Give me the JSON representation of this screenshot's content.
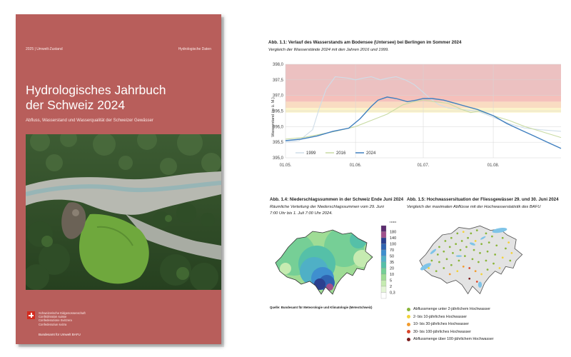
{
  "cover": {
    "top_left": "2025 | Umwelt-Zustand",
    "top_right": "Hydrologische Daten",
    "title_line1": "Hydrologisches Jahrbuch",
    "title_line2": "der Schweiz 2024",
    "subtitle": "Abfluss, Wasserstand und Wasserqualität der Schweizer Gewässer",
    "confederation": [
      "Schweizerische Eidgenossenschaft",
      "Confédération suisse",
      "Confederazione Svizzera",
      "Confederaziun svizra"
    ],
    "office": "Bundesamt für Umwelt BAFU",
    "colors": {
      "background": "#b85e5b"
    }
  },
  "fig11": {
    "title": "Abb. 1.1: Verlauf des Wasserstands am Bodensee (Untersee) bei Berlingen im Sommer 2024",
    "subtitle": "Vergleich der Wasserstände 2024 mit den Jahren 2016 und 1999.",
    "chart_data": {
      "type": "line",
      "ylabel": "Wasserstand (m ü. M.)",
      "ylim": [
        395.0,
        398.0
      ],
      "yticks": [
        "398,0",
        "397,5",
        "397,0",
        "396,5",
        "396,0",
        "395,5",
        "395,0"
      ],
      "x_axis": {
        "start": "2024-05-01",
        "end": "2024-08-31"
      },
      "xticks": [
        {
          "date": "2024-05-01",
          "label": "01.05."
        },
        {
          "date": "2024-06-01",
          "label": "01.06."
        },
        {
          "date": "2024-07-01",
          "label": "01.07."
        },
        {
          "date": "2024-08-01",
          "label": "01.08."
        }
      ],
      "bands": [
        {
          "from": 397.0,
          "to": 398.0,
          "color": "#ecc1c1"
        },
        {
          "from": 396.8,
          "to": 397.0,
          "color": "#f5c0bb"
        },
        {
          "from": 396.6,
          "to": 396.8,
          "color": "#f9dcc2"
        },
        {
          "from": 396.45,
          "to": 396.6,
          "color": "#fbf3c9"
        }
      ],
      "series": [
        {
          "name": "1999",
          "color": "#cfdde8",
          "points": [
            [
              "2024-05-01",
              395.5
            ],
            [
              "2024-05-07",
              395.55
            ],
            [
              "2024-05-13",
              395.9
            ],
            [
              "2024-05-16",
              396.6
            ],
            [
              "2024-05-19",
              397.2
            ],
            [
              "2024-05-23",
              397.6
            ],
            [
              "2024-05-29",
              397.55
            ],
            [
              "2024-06-01",
              397.5
            ],
            [
              "2024-06-04",
              397.55
            ],
            [
              "2024-06-08",
              397.6
            ],
            [
              "2024-06-12",
              397.5
            ],
            [
              "2024-06-15",
              397.55
            ],
            [
              "2024-06-19",
              397.6
            ],
            [
              "2024-06-23",
              397.5
            ],
            [
              "2024-06-27",
              397.35
            ],
            [
              "2024-07-01",
              397.1
            ],
            [
              "2024-07-04",
              396.9
            ],
            [
              "2024-07-08",
              396.7
            ],
            [
              "2024-07-12",
              396.6
            ],
            [
              "2024-07-18",
              396.55
            ],
            [
              "2024-07-25",
              396.5
            ],
            [
              "2024-08-01",
              396.3
            ],
            [
              "2024-08-08",
              396.1
            ],
            [
              "2024-08-15",
              395.95
            ],
            [
              "2024-08-22",
              395.9
            ],
            [
              "2024-08-31",
              395.85
            ]
          ]
        },
        {
          "name": "2016",
          "color": "#c9dba4",
          "points": [
            [
              "2024-05-01",
              395.6
            ],
            [
              "2024-05-09",
              395.65
            ],
            [
              "2024-05-16",
              395.75
            ],
            [
              "2024-05-23",
              395.85
            ],
            [
              "2024-06-01",
              396.0
            ],
            [
              "2024-06-08",
              396.2
            ],
            [
              "2024-06-15",
              396.4
            ],
            [
              "2024-06-22",
              396.7
            ],
            [
              "2024-06-27",
              396.8
            ],
            [
              "2024-07-01",
              396.85
            ],
            [
              "2024-07-06",
              396.8
            ],
            [
              "2024-07-12",
              396.75
            ],
            [
              "2024-07-18",
              396.55
            ],
            [
              "2024-07-22",
              396.45
            ],
            [
              "2024-07-26",
              396.5
            ],
            [
              "2024-08-01",
              396.35
            ],
            [
              "2024-08-08",
              396.2
            ],
            [
              "2024-08-15",
              396.0
            ],
            [
              "2024-08-22",
              395.85
            ],
            [
              "2024-08-31",
              395.65
            ]
          ]
        },
        {
          "name": "2024",
          "color": "#3f7fbf",
          "points": [
            [
              "2024-05-01",
              395.55
            ],
            [
              "2024-05-08",
              395.6
            ],
            [
              "2024-05-15",
              395.7
            ],
            [
              "2024-05-22",
              395.85
            ],
            [
              "2024-05-29",
              395.95
            ],
            [
              "2024-06-03",
              396.25
            ],
            [
              "2024-06-08",
              396.65
            ],
            [
              "2024-06-11",
              396.85
            ],
            [
              "2024-06-15",
              396.95
            ],
            [
              "2024-06-19",
              396.9
            ],
            [
              "2024-06-24",
              396.8
            ],
            [
              "2024-06-28",
              396.85
            ],
            [
              "2024-07-01",
              396.9
            ],
            [
              "2024-07-05",
              396.9
            ],
            [
              "2024-07-10",
              396.85
            ],
            [
              "2024-07-15",
              396.75
            ],
            [
              "2024-07-20",
              396.65
            ],
            [
              "2024-07-25",
              396.55
            ],
            [
              "2024-08-01",
              396.35
            ],
            [
              "2024-08-07",
              396.1
            ],
            [
              "2024-08-13",
              395.9
            ],
            [
              "2024-08-19",
              395.7
            ],
            [
              "2024-08-25",
              395.5
            ],
            [
              "2024-08-31",
              395.3
            ]
          ]
        }
      ],
      "legend": "bottom-left"
    }
  },
  "fig14": {
    "title": "Abb. 1.4: Niederschlagssummen in der Schweiz Ende Juni 2024",
    "subtitle_line1": "Räumliche Verteilung der Niederschlagssummen vom 29. Juni",
    "subtitle_line2": "7:00 Uhr bis 1. Juli 7:00 Uhr 2024.",
    "unit": "mm",
    "scale_labels": [
      "180",
      "140",
      "100",
      "70",
      "50",
      "35",
      "20",
      "10",
      "5",
      "2",
      "0,3"
    ],
    "scale_colors": [
      "#5b2c6f",
      "#a0508c",
      "#2b3f8f",
      "#2f63b1",
      "#3f8fcf",
      "#4fb0c6",
      "#55c0a8",
      "#76cf96",
      "#9fdc95",
      "#c6ebb1",
      "#e4f5d6",
      "#ffffff"
    ],
    "source": "Quelle: Bundesamt für Meteorologie und Klimatologie (MeteoSchweiz)"
  },
  "fig15": {
    "title": "Abb. 1.5: Hochwassersituation der Fliessgewässer 29. und 30. Juni 2024",
    "subtitle": "Vergleich der maximalen Abflüsse mit der Hochwasserstatistik des BAFU",
    "legend": [
      {
        "label": "Abflussmenge unter 2-jährlichem Hochwasser",
        "color": "#8ab53a"
      },
      {
        "label": "2- bis 10-jährliches Hochwasser",
        "color": "#f2d23a"
      },
      {
        "label": "10- bis 30-jährliches Hochwasser",
        "color": "#f29b2e"
      },
      {
        "label": "30- bis 100-jährliches Hochwasser",
        "color": "#d9482b"
      },
      {
        "label": "Abflussmenge über 100-jährlichem Hochwasser",
        "color": "#7b1e1e"
      }
    ]
  }
}
